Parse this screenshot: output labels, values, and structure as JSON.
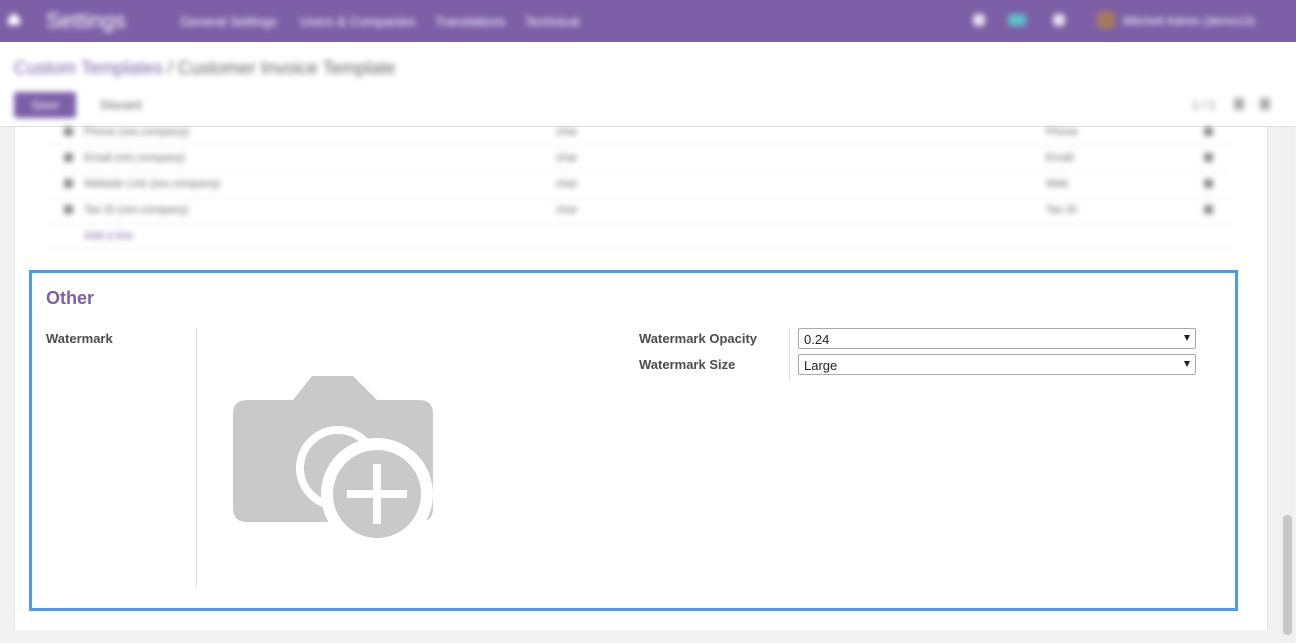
{
  "topbar": {
    "app_name": "Settings",
    "menus": [
      "General Settings",
      "Users & Companies",
      "Translations",
      "Technical"
    ],
    "user": "Mitchell Admin (demo13)"
  },
  "breadcrumb": {
    "parent": "Custom Templates",
    "separator": " / ",
    "current": "Customer Invoice Template"
  },
  "toolbar": {
    "save_label": "Save",
    "discard_label": "Discard",
    "pager": "1 / 1"
  },
  "lines": {
    "rows": [
      {
        "name": "Phone (res.company)",
        "type": "char",
        "string": "Phone"
      },
      {
        "name": "Email (res.company)",
        "type": "char",
        "string": "Email"
      },
      {
        "name": "Website Link (res.company)",
        "type": "char",
        "string": "Web"
      },
      {
        "name": "Tax ID (res.company)",
        "type": "char",
        "string": "Tax ID"
      }
    ],
    "add_line": "Add a line"
  },
  "other": {
    "title": "Other",
    "watermark_label": "Watermark",
    "opacity_label": "Watermark Opacity",
    "opacity_value": "0.24",
    "size_label": "Watermark Size",
    "size_value": "Large"
  },
  "colors": {
    "brand": "#7c5fa7",
    "focus": "#4a9af1",
    "placeholder": "#c9c9c9"
  },
  "icons": {
    "watermark_image": "camera-plus-icon"
  }
}
